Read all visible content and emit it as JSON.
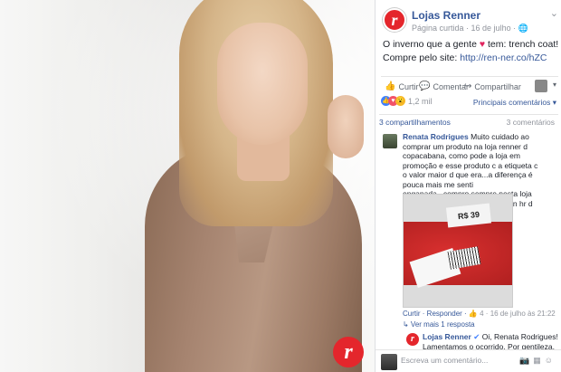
{
  "post": {
    "page_name": "Lojas Renner",
    "meta": "Página curtida · 16 de julho · ",
    "text_before_heart": "O inverno que a gente ",
    "heart": "♥",
    "text_after_heart": " tem: trench coat! Compre pelo site: ",
    "link": "http://ren-ner.co/hZC"
  },
  "actions": {
    "like": "Curtir",
    "comment": "Comentar",
    "share": "Compartilhar"
  },
  "reactions": {
    "count": "1,2 mil",
    "sort": "Principais comentários ▾"
  },
  "counts": {
    "shares": "3 compartilhamentos",
    "comments": "3 comentários"
  },
  "comment": {
    "name": "Renata Rodrigues",
    "text": "Muito cuidado ao comprar um produto na loja renner d copacabana, como pode a loja em promoção e esse produto c a etiqueta c o valor maior d que era...a diferença é pouca mais me senti enganada...compro sempre nesta loja agora vou prestar mais atenção n hr d comprar qualquer produto.",
    "price_tag": "R$ 39",
    "meta_actions": "Curtir · Responder · ",
    "like_count": "4",
    "date": " · 16 de julho às 21:22",
    "more_replies": "↳ Ver mais 1 resposta"
  },
  "reply": {
    "name": "Lojas Renner",
    "text1": " Oi, Renata Rodrigues!",
    "text2": "Lamentamos o ocorrido. Por gentileza,"
  },
  "input": {
    "placeholder": "Escreva um comentário..."
  }
}
